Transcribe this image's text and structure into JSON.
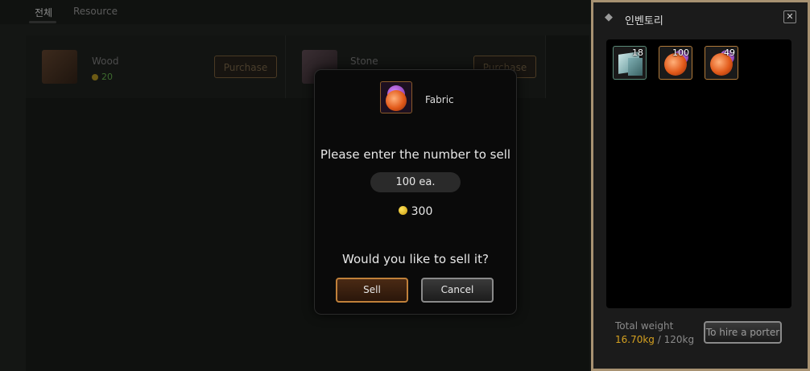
{
  "shop": {
    "tabs": [
      {
        "label": "전체"
      },
      {
        "label": "Resource"
      }
    ],
    "items": [
      {
        "name": "Wood",
        "price": "20",
        "button": "Purchase"
      },
      {
        "name": "Stone",
        "button": "Purchase"
      }
    ]
  },
  "dialog": {
    "item_name": "Fabric",
    "prompt": "Please enter the number to sell",
    "quantity": "100 ea.",
    "total_price": "300",
    "confirm_text": "Would you like to sell it?",
    "sell_label": "Sell",
    "cancel_label": "Cancel"
  },
  "inventory": {
    "title": "인벤토리",
    "close_symbol": "✕",
    "slots": [
      {
        "icon": "cube-icon",
        "count": "18"
      },
      {
        "icon": "fabric-icon",
        "count": "100"
      },
      {
        "icon": "fabric-icon",
        "count": "49"
      }
    ],
    "weight_label": "Total weight",
    "weight_current": "16.70kg",
    "weight_separator": " / ",
    "weight_max": "120kg",
    "porter_label": "To hire a porter"
  },
  "colors": {
    "accent_gold": "#d4a020",
    "frame": "#a89272",
    "sell_border": "#c0803a"
  }
}
